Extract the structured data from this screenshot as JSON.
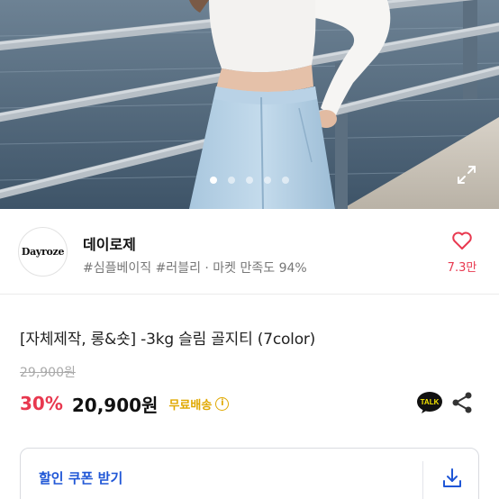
{
  "gallery": {
    "dot_count": 5,
    "active_index": 0,
    "expand_icon": "expand-icon"
  },
  "shop": {
    "logo_text": "Dayroze",
    "name": "데이로제",
    "meta": "#심플베이직 #러블리 · 마켓 만족도 94%",
    "like_icon": "heart-icon",
    "like_count": "7.3만"
  },
  "product": {
    "title": "[자체제작, 롱&숏] -3kg 슬림 골지티 (7color)",
    "original_price": "29,900원",
    "discount": "30%",
    "price": "20,900원",
    "shipping": "무료배송",
    "shipping_info_icon": "info-icon",
    "talk_label": "TALK",
    "share_icon": "share-icon"
  },
  "coupon": {
    "label": "할인 쿠폰 받기",
    "download_icon": "download-icon"
  },
  "colors": {
    "accent_red": "#e8384f",
    "coupon_blue": "#1f56d6",
    "shipping_yellow": "#e0a800"
  }
}
